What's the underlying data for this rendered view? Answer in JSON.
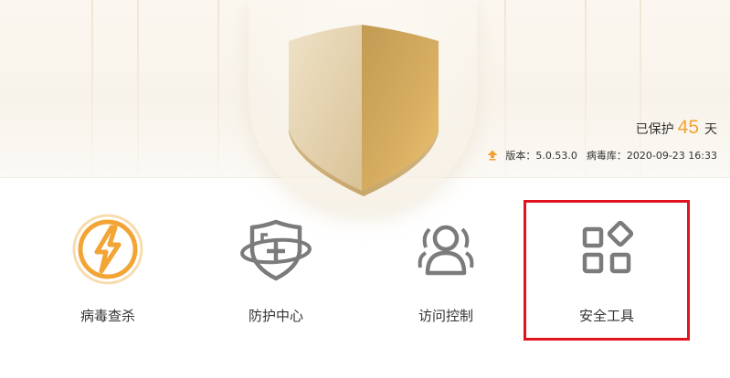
{
  "colors": {
    "accent_orange": "#f2a434",
    "shield_gold": "#d7b577",
    "icon_gray": "#7b7b7b",
    "selection_red": "#e0141e",
    "text": "#333333"
  },
  "status": {
    "protected_prefix": "已保护",
    "protected_days": "45",
    "protected_suffix": "天",
    "version_label": "版本：",
    "version_value": "5.0.53.0",
    "virus_db_label": "病毒库：",
    "virus_db_value": "2020-09-23 16:33",
    "update_icon": "upgrade-arrow-icon"
  },
  "features": [
    {
      "label": "病毒查杀",
      "icon": "virus-scan-lightning-icon"
    },
    {
      "label": "防护中心",
      "icon": "protection-center-shield-icon"
    },
    {
      "label": "访问控制",
      "icon": "access-control-users-icon"
    },
    {
      "label": "安全工具",
      "icon": "security-tools-grid-icon",
      "selected": true
    }
  ]
}
